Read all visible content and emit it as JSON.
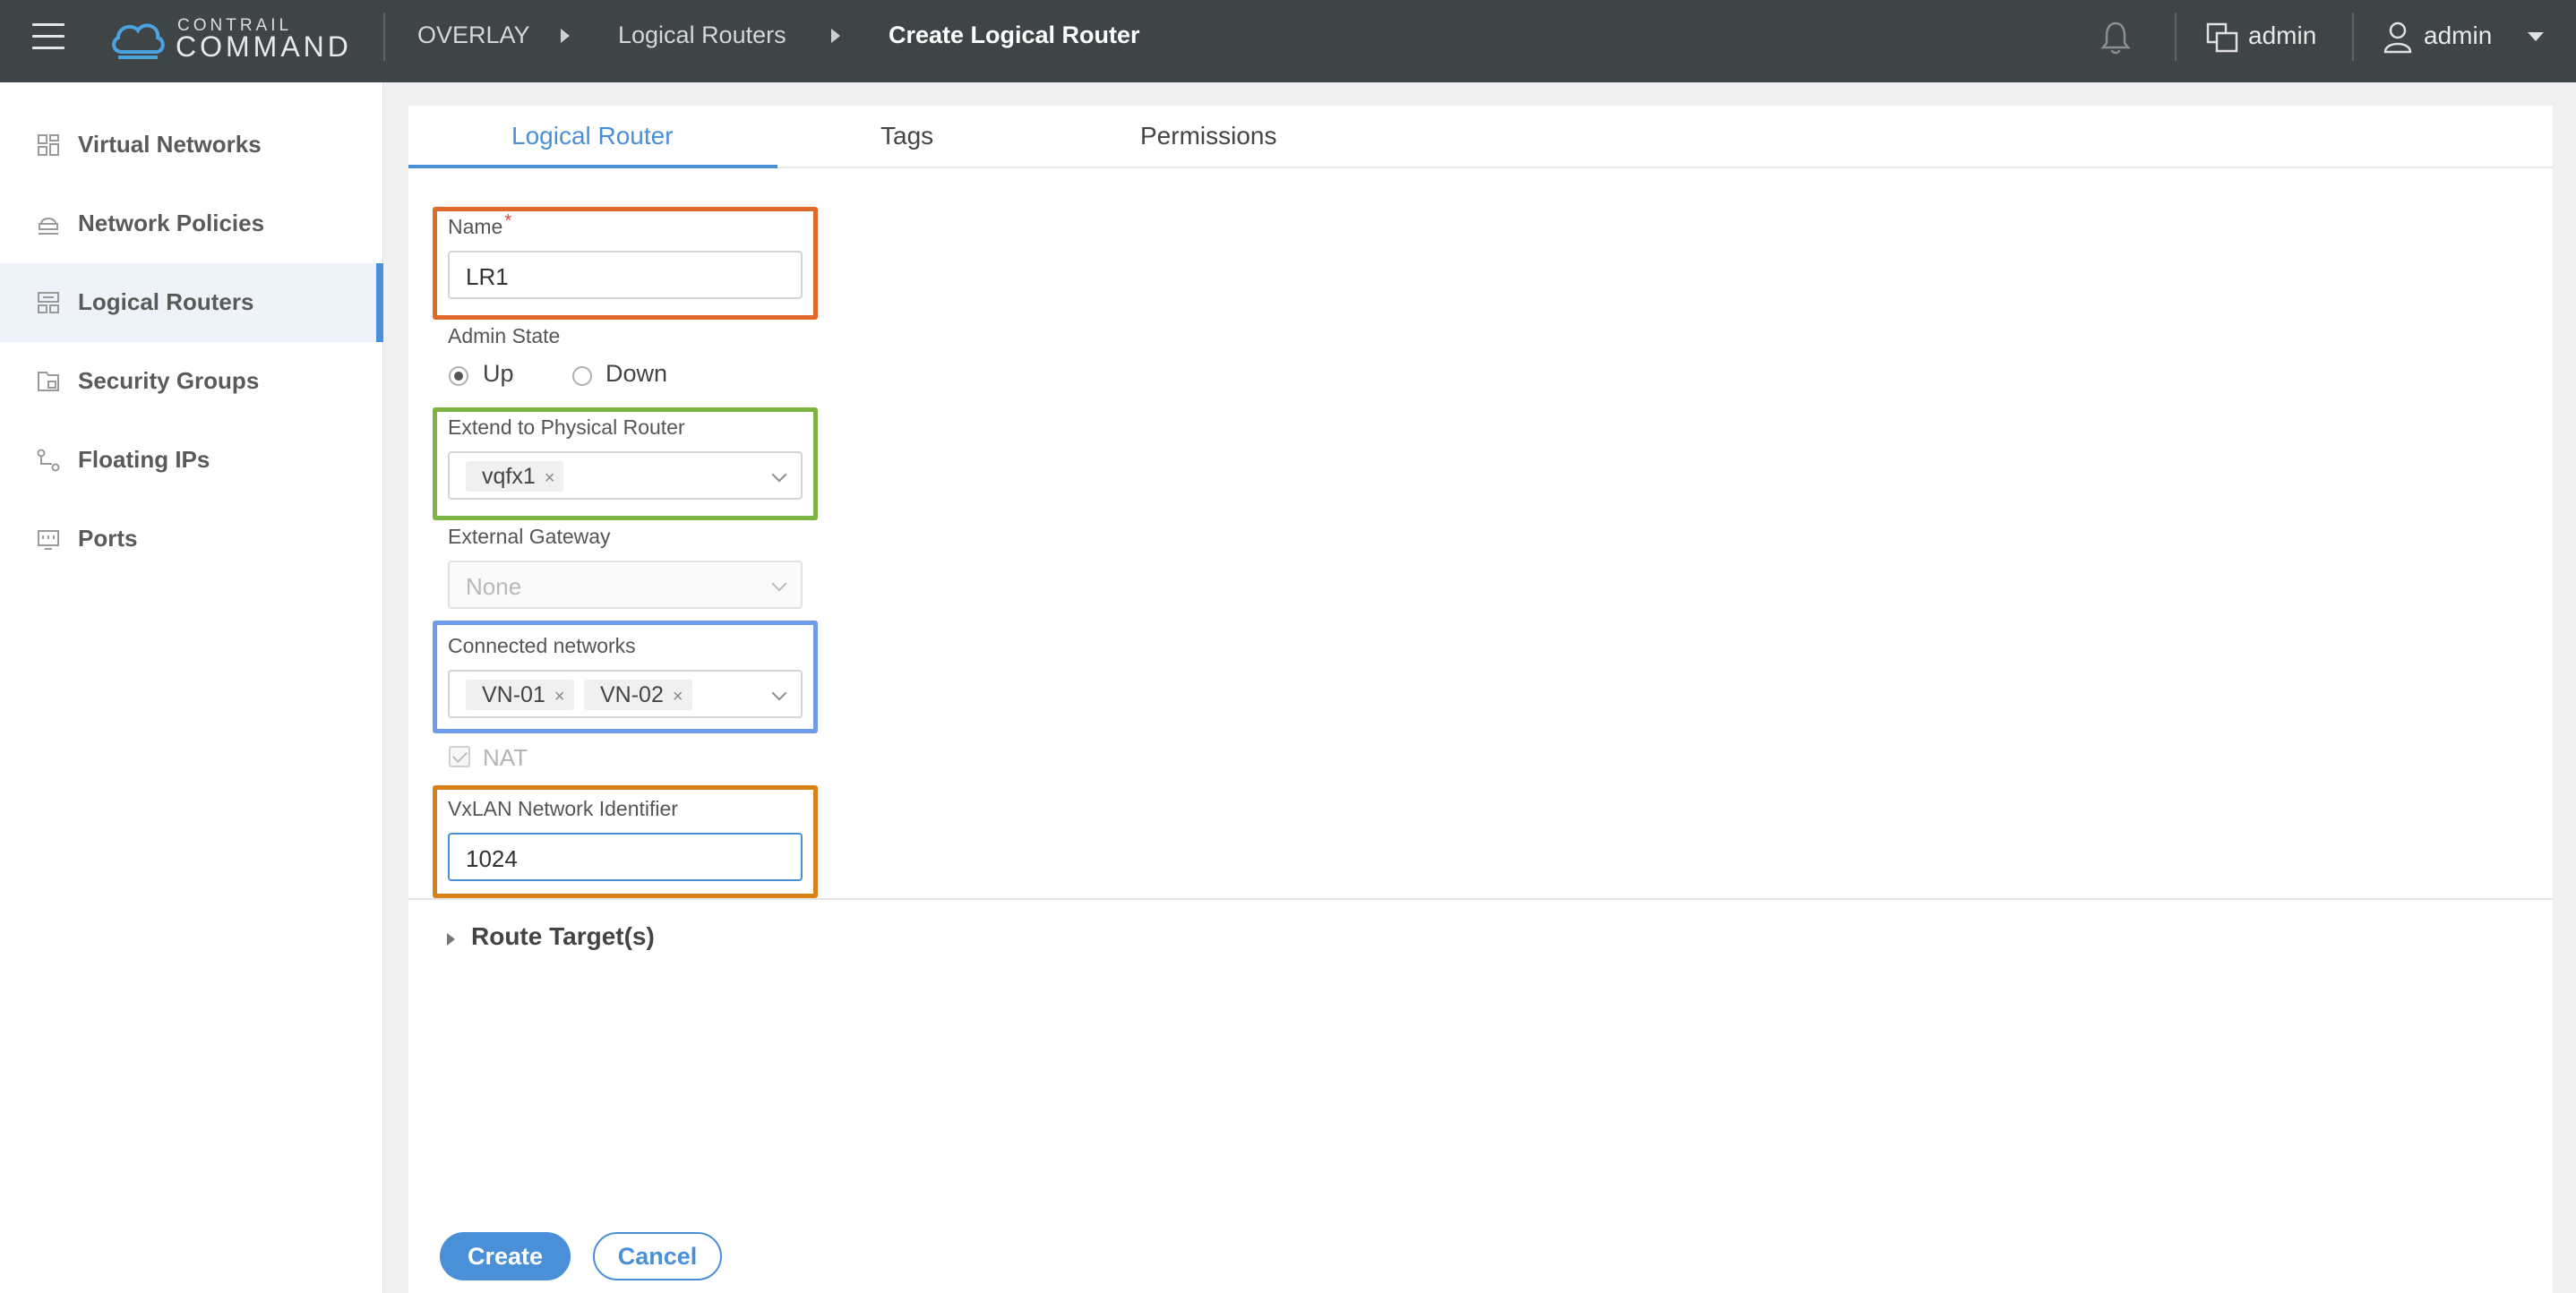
{
  "app": {
    "logo_small": "CONTRAIL",
    "logo_big": "COMMAND",
    "brand_color": "#4a90d9"
  },
  "breadcrumb": {
    "items": [
      "OVERLAY",
      "Logical Routers",
      "Create Logical Router"
    ]
  },
  "header": {
    "org_label": "admin",
    "user_label": "admin",
    "icons": [
      "menu-icon",
      "bell-icon",
      "org-switch-icon",
      "user-icon",
      "caret-down-icon"
    ]
  },
  "sidebar": {
    "items": [
      {
        "label": "Virtual Networks",
        "icon": "virtual-networks-icon",
        "active": false
      },
      {
        "label": "Network Policies",
        "icon": "network-policies-icon",
        "active": false
      },
      {
        "label": "Logical Routers",
        "icon": "logical-routers-icon",
        "active": true
      },
      {
        "label": "Security Groups",
        "icon": "security-groups-icon",
        "active": false
      },
      {
        "label": "Floating IPs",
        "icon": "floating-ips-icon",
        "active": false
      },
      {
        "label": "Ports",
        "icon": "ports-icon",
        "active": false
      }
    ]
  },
  "tabs": [
    {
      "label": "Logical Router",
      "active": true
    },
    {
      "label": "Tags",
      "active": false
    },
    {
      "label": "Permissions",
      "active": false
    }
  ],
  "form": {
    "name": {
      "label": "Name",
      "required_mark": "*",
      "value": "LR1"
    },
    "admin_state": {
      "label": "Admin State",
      "options": [
        "Up",
        "Down"
      ],
      "selected": "Up"
    },
    "extend_physical_router": {
      "label": "Extend to Physical Router",
      "tags": [
        "vqfx1"
      ],
      "remove_glyph": "×"
    },
    "external_gateway": {
      "label": "External Gateway",
      "value": "None"
    },
    "connected_networks": {
      "label": "Connected networks",
      "tags": [
        "VN-01",
        "VN-02"
      ],
      "remove_glyph": "×"
    },
    "nat": {
      "label": "NAT",
      "checked": true,
      "disabled": true
    },
    "vxlan": {
      "label": "VxLAN Network Identifier",
      "value": "1024"
    },
    "route_targets": {
      "label": "Route Target(s)"
    }
  },
  "buttons": {
    "create": "Create",
    "cancel": "Cancel"
  },
  "highlight_colors": {
    "name": "#e0692a",
    "extend_physical_router": "#7cb342",
    "connected_networks": "#6f9be8",
    "vxlan": "#d98019"
  }
}
